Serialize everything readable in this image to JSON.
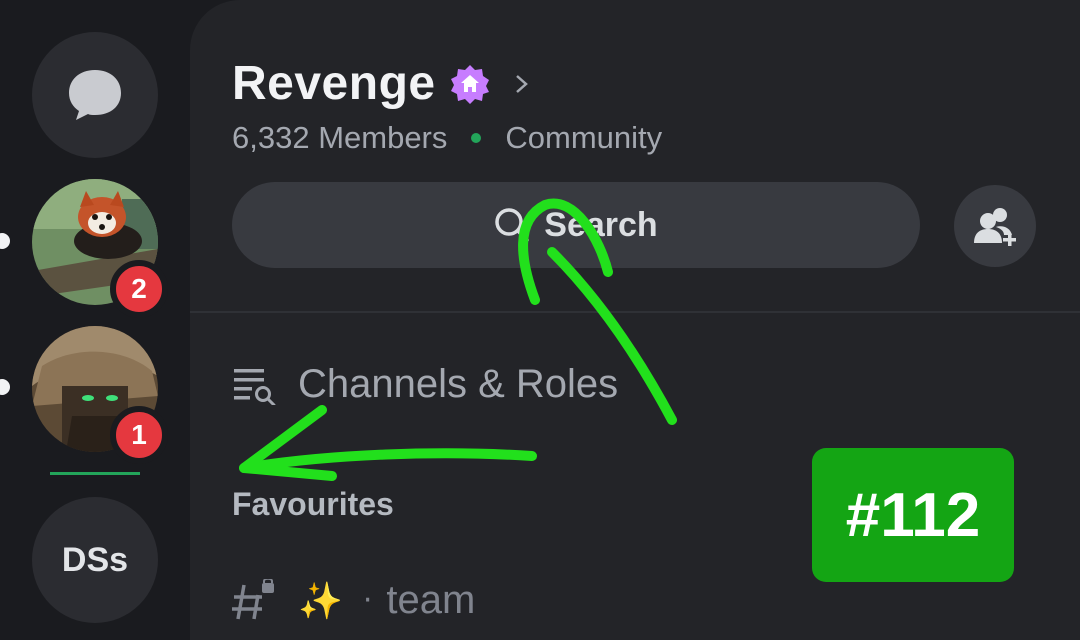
{
  "server_rail": {
    "dms_button_icon": "chat-bubble-icon",
    "servers": [
      {
        "name": "red panda server",
        "badge": "2",
        "unread": true
      },
      {
        "name": "anime character server",
        "badge": "1",
        "unread": true
      }
    ],
    "dss_label": "DSs"
  },
  "header": {
    "server_name": "Revenge",
    "boost_icon": "home-badge-icon",
    "member_count": "6,332 Members",
    "community_label": "Community"
  },
  "search": {
    "label": "Search"
  },
  "channels_roles": {
    "label": "Channels & Roles"
  },
  "category": {
    "label": "Favourites"
  },
  "channel": {
    "emoji": "✨",
    "separator": "·",
    "name": "team"
  },
  "annotation": {
    "tag": "#112",
    "arrow_color": "#22e01c",
    "tag_color": "#14a514"
  },
  "colors": {
    "accent_green": "#23a55a",
    "badge_red": "#e5383f",
    "boost_purple": "#c77dff"
  }
}
